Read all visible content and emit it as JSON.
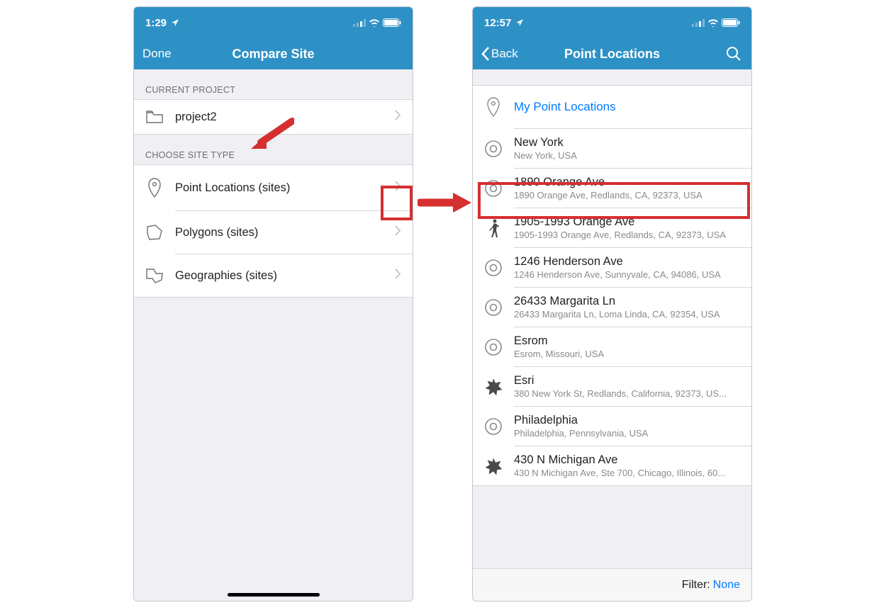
{
  "left": {
    "status_time": "1:29",
    "nav_done": "Done",
    "nav_title": "Compare Site",
    "section_current_project": "CURRENT PROJECT",
    "project_name": "project2",
    "section_site_type": "CHOOSE SITE TYPE",
    "site_types": {
      "point": "Point Locations (sites)",
      "polygon": "Polygons (sites)",
      "geography": "Geographies (sites)"
    }
  },
  "right": {
    "status_time": "12:57",
    "nav_back": "Back",
    "nav_title": "Point Locations",
    "my_point_locations": "My Point Locations",
    "items": [
      {
        "title": "New York",
        "subtitle": "New York, USA",
        "icon": "radio"
      },
      {
        "title": "1890 Orange Ave",
        "subtitle": "1890 Orange Ave, Redlands, CA, 92373, USA",
        "icon": "radio"
      },
      {
        "title": "1905-1993 Orange Ave",
        "subtitle": "1905-1993 Orange Ave, Redlands, CA, 92373, USA",
        "icon": "walk"
      },
      {
        "title": "1246 Henderson Ave",
        "subtitle": "1246 Henderson Ave, Sunnyvale, CA, 94086, USA",
        "icon": "radio"
      },
      {
        "title": "26433 Margarita Ln",
        "subtitle": "26433 Margarita Ln, Loma Linda, CA, 92354, USA",
        "icon": "radio"
      },
      {
        "title": "Esrom",
        "subtitle": "Esrom, Missouri, USA",
        "icon": "radio"
      },
      {
        "title": "Esri",
        "subtitle": "380 New York St, Redlands, California, 92373, US...",
        "icon": "star"
      },
      {
        "title": "Philadelphia",
        "subtitle": "Philadelphia, Pennsylvania, USA",
        "icon": "radio"
      },
      {
        "title": "430 N Michigan Ave",
        "subtitle": "430 N Michigan Ave, Ste 700, Chicago, Illinois, 60...",
        "icon": "star"
      }
    ],
    "filter_label": "Filter:",
    "filter_value": "None"
  }
}
